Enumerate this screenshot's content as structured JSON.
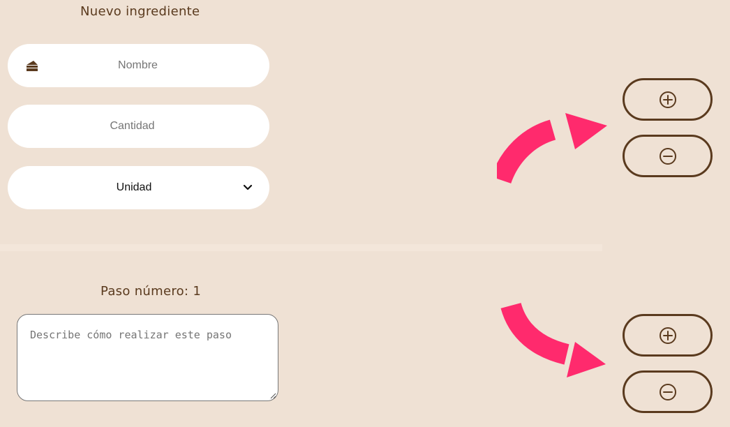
{
  "ingredient": {
    "title": "Nuevo ingrediente",
    "name_placeholder": "Nombre",
    "quantity_placeholder": "Cantidad",
    "unit_selected": "Unidad",
    "name_icon": "cake-slice-icon"
  },
  "step": {
    "title": "Paso número: 1",
    "description_placeholder": "Describe cómo realizar este paso"
  },
  "icons": {
    "add": "plus-circle-icon",
    "remove": "minus-circle-icon",
    "arrow": "curved-arrow-icon"
  },
  "colors": {
    "background": "#efe1d4",
    "brown": "#5a3a1e",
    "arrow": "#ff2a6d"
  }
}
